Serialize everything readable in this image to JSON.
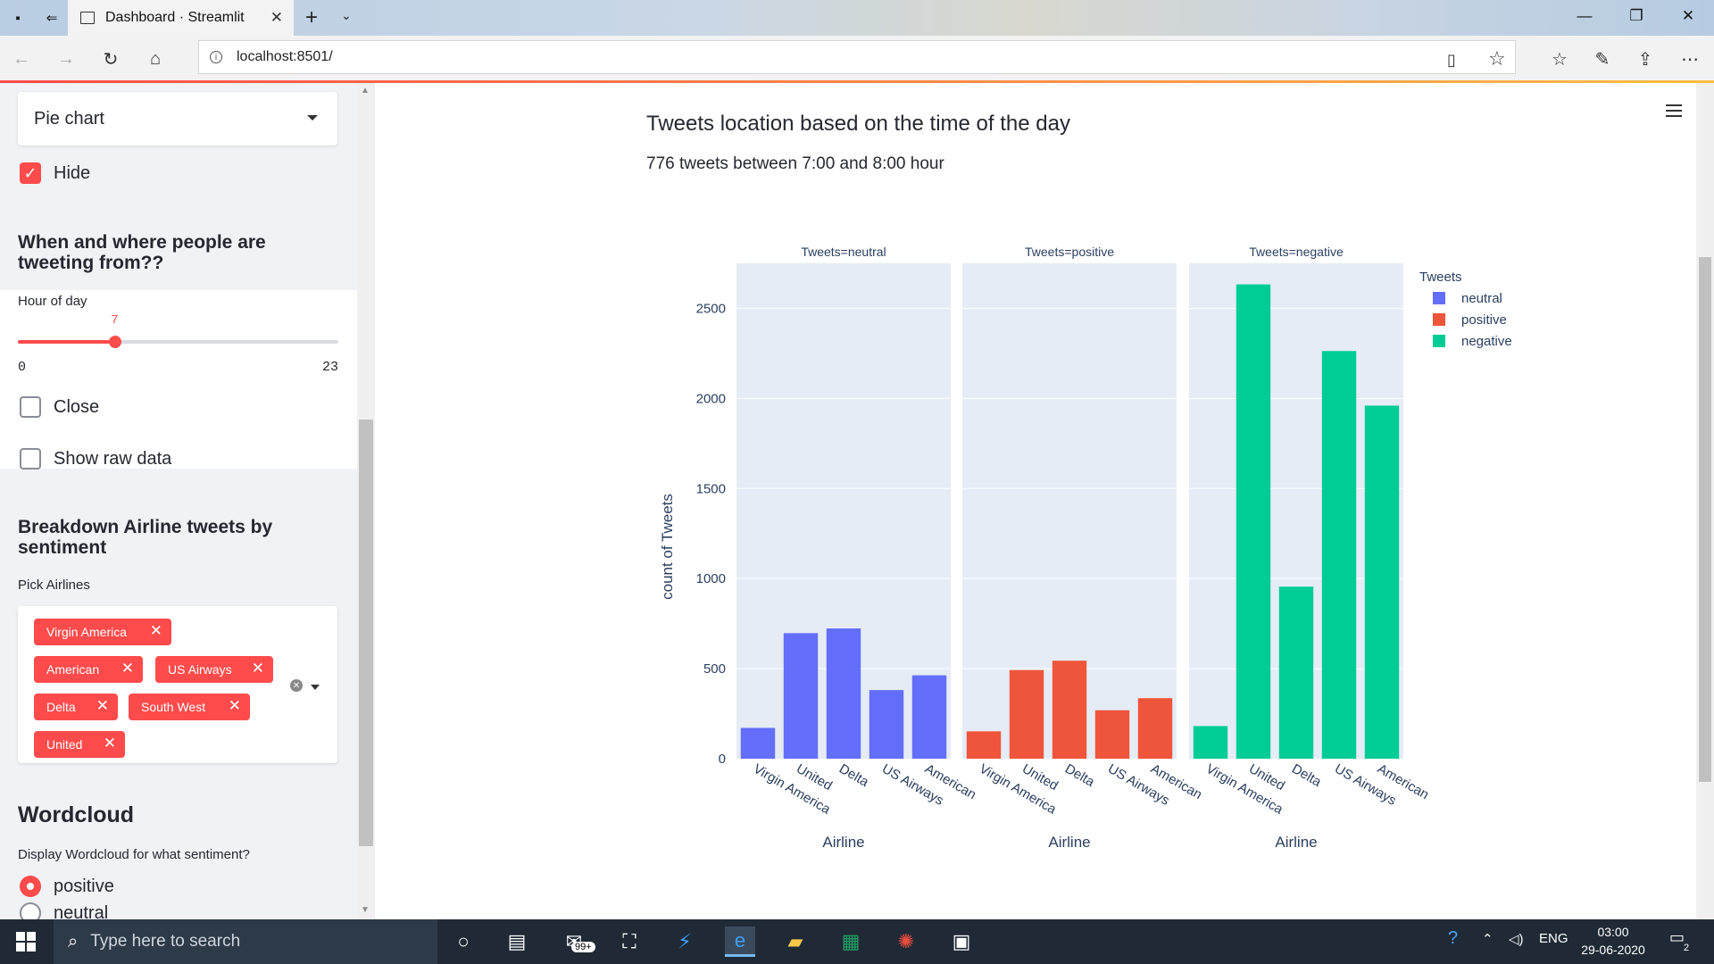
{
  "browser": {
    "tab_title": "Dashboard · Streamlit",
    "url": "localhost:8501/"
  },
  "sidebar": {
    "chart_select_value": "Pie chart",
    "hide_checkbox_label": "Hide",
    "hide_checked": true,
    "section1_heading": "When and where people are tweeting from??",
    "slider": {
      "label": "Hour of day",
      "value": "7",
      "min": "0",
      "max": "23",
      "fraction": 0.3043
    },
    "close_checkbox_label": "Close",
    "show_raw_label": "Show raw data",
    "section2_heading": "Breakdown Airline tweets by sentiment",
    "pick_airlines_label": "Pick Airlines",
    "airline_chips": [
      "Virgin America",
      "American",
      "US Airways",
      "Delta",
      "South West",
      "United"
    ],
    "wordcloud_heading": "Wordcloud",
    "wordcloud_question": "Display Wordcloud for what sentiment?",
    "radio_options": [
      "positive",
      "neutral"
    ],
    "radio_selected": "positive"
  },
  "main": {
    "title": "Tweets location based on the time of the day",
    "subtitle": "776 tweets between 7:00 and 8:00 hour"
  },
  "chart_data": {
    "type": "bar",
    "facet_titles": [
      "Tweets=neutral",
      "Tweets=positive",
      "Tweets=negative"
    ],
    "categories": [
      "Virgin America",
      "United",
      "Delta",
      "US Airways",
      "American"
    ],
    "series": [
      {
        "name": "neutral",
        "color": "#636efa",
        "values": [
          171,
          697,
          723,
          381,
          463
        ]
      },
      {
        "name": "positive",
        "color": "#ef553b",
        "values": [
          152,
          492,
          544,
          269,
          336
        ]
      },
      {
        "name": "negative",
        "color": "#00cc96",
        "values": [
          181,
          2633,
          955,
          2263,
          1960
        ]
      }
    ],
    "xlabel": "Airline",
    "ylabel": "count of Tweets",
    "ylim": [
      0,
      2750
    ],
    "yticks": [
      0,
      500,
      1000,
      1500,
      2000,
      2500
    ],
    "legend_title": "Tweets",
    "legend_position": "top-right",
    "grid": true
  },
  "taskbar": {
    "search_placeholder": "Type here to search",
    "mail_badge": "99+",
    "language": "ENG",
    "time": "03:00",
    "date": "29-06-2020",
    "notification_count": "2"
  }
}
